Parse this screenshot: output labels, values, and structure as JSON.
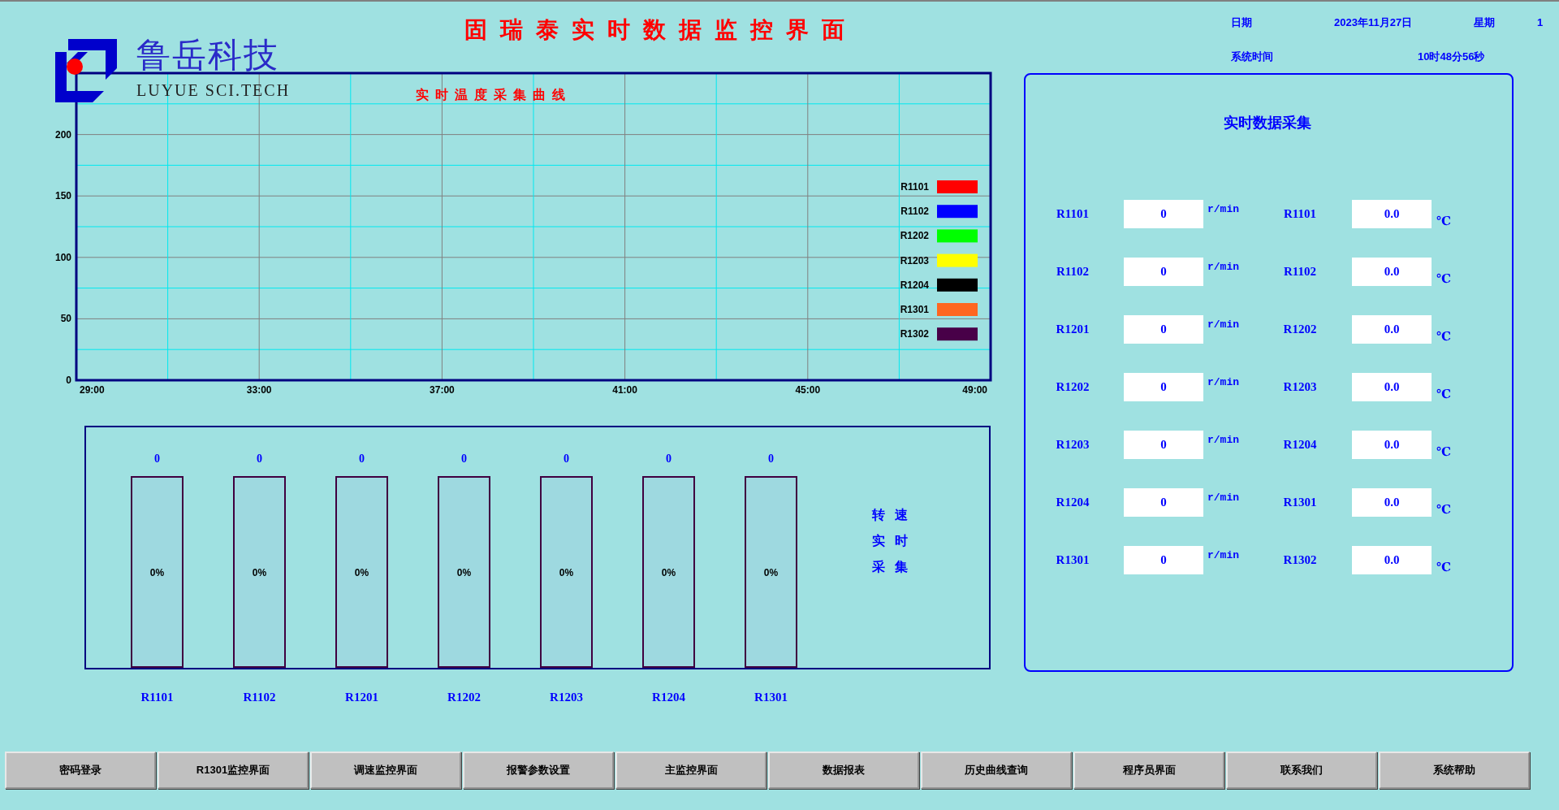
{
  "header": {
    "title": "固瑞泰实时数据监控界面",
    "brand": {
      "name": "鲁岳科技",
      "subtitle": "LUYUE SCI.TECH"
    },
    "date_label": "日期",
    "date": "2023年11月27日",
    "weekday_label": "星期",
    "weekday": "1",
    "time_label": "系统时间",
    "time": "10时48分56秒"
  },
  "temperature_chart": {
    "chart_data": {
      "type": "line",
      "title": "实时温度采集曲线",
      "grid": true,
      "ylim": [
        0,
        250
      ],
      "categories": [
        "29:00",
        "33:00",
        "37:00",
        "41:00",
        "45:00",
        "49:00"
      ],
      "yticks": [
        0,
        50,
        100,
        150,
        200
      ],
      "series": [
        {
          "name": "R1101",
          "color": "#ff0000",
          "values": [
            null,
            null,
            null,
            null,
            null,
            null
          ]
        },
        {
          "name": "R1102",
          "color": "#0000ff",
          "values": [
            null,
            null,
            null,
            null,
            null,
            null
          ]
        },
        {
          "name": "R1202",
          "color": "#00ff00",
          "values": [
            null,
            null,
            null,
            null,
            null,
            null
          ]
        },
        {
          "name": "R1203",
          "color": "#ffff00",
          "values": [
            null,
            null,
            null,
            null,
            null,
            null
          ]
        },
        {
          "name": "R1204",
          "color": "#000000",
          "values": [
            null,
            null,
            null,
            null,
            null,
            null
          ]
        },
        {
          "name": "R1301",
          "color": "#ff6620",
          "values": [
            null,
            null,
            null,
            null,
            null,
            null
          ]
        },
        {
          "name": "R1302",
          "color": "#480048",
          "values": [
            null,
            null,
            null,
            null,
            null,
            null
          ]
        }
      ]
    }
  },
  "speed_meters": {
    "caption": [
      "转速",
      "实时",
      "采集"
    ],
    "meters": [
      {
        "name": "R1101",
        "reading": "0",
        "percent": "0%",
        "level": 0
      },
      {
        "name": "R1102",
        "reading": "0",
        "percent": "0%",
        "level": 0
      },
      {
        "name": "R1201",
        "reading": "0",
        "percent": "0%",
        "level": 0
      },
      {
        "name": "R1202",
        "reading": "0",
        "percent": "0%",
        "level": 0
      },
      {
        "name": "R1203",
        "reading": "0",
        "percent": "0%",
        "level": 0
      },
      {
        "name": "R1204",
        "reading": "0",
        "percent": "0%",
        "level": 0
      },
      {
        "name": "R1301",
        "reading": "0",
        "percent": "0%",
        "level": 0
      }
    ]
  },
  "data_panel": {
    "title": "实时数据采集",
    "rows": [
      {
        "speed_label": "R1101",
        "speed_value": "0",
        "speed_unit": "r/min",
        "temp_label": "R1101",
        "temp_value": "0.0",
        "temp_unit": "℃"
      },
      {
        "speed_label": "R1102",
        "speed_value": "0",
        "speed_unit": "r/min",
        "temp_label": "R1102",
        "temp_value": "0.0",
        "temp_unit": "℃"
      },
      {
        "speed_label": "R1201",
        "speed_value": "0",
        "speed_unit": "r/min",
        "temp_label": "R1202",
        "temp_value": "0.0",
        "temp_unit": "℃"
      },
      {
        "speed_label": "R1202",
        "speed_value": "0",
        "speed_unit": "r/min",
        "temp_label": "R1203",
        "temp_value": "0.0",
        "temp_unit": "℃"
      },
      {
        "speed_label": "R1203",
        "speed_value": "0",
        "speed_unit": "r/min",
        "temp_label": "R1204",
        "temp_value": "0.0",
        "temp_unit": "℃"
      },
      {
        "speed_label": "R1204",
        "speed_value": "0",
        "speed_unit": "r/min",
        "temp_label": "R1301",
        "temp_value": "0.0",
        "temp_unit": "℃"
      },
      {
        "speed_label": "R1301",
        "speed_value": "0",
        "speed_unit": "r/min",
        "temp_label": "R1302",
        "temp_value": "0.0",
        "temp_unit": "℃"
      }
    ]
  },
  "buttons": [
    "密码登录",
    "R1301监控界面",
    "调速监控界面",
    "报警参数设置",
    "主监控界面",
    "数据报表",
    "历史曲线查询",
    "程序员界面",
    "联系我们",
    "系统帮助"
  ]
}
